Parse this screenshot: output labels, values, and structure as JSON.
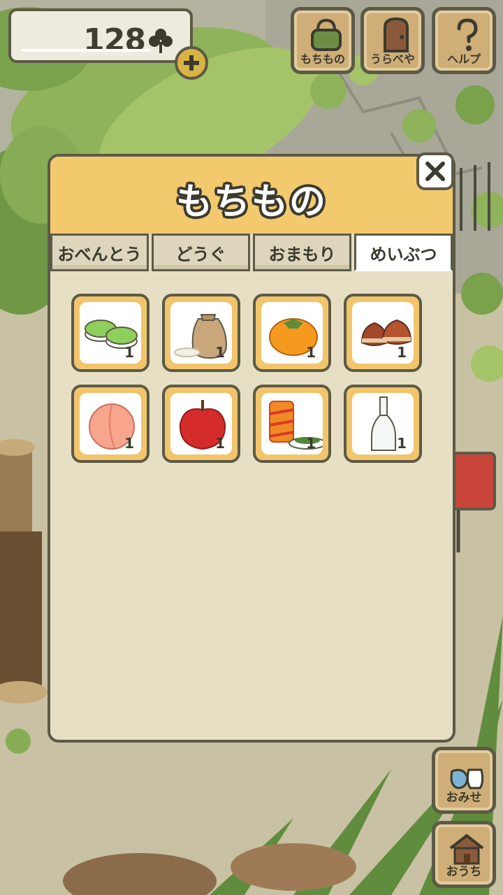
{
  "clover_counter": {
    "value": "128",
    "icon": "clover-icon",
    "add_icon": "plus-icon"
  },
  "top_menu": [
    {
      "label": "もちもの",
      "icon": "bag-icon"
    },
    {
      "label": "うらべや",
      "icon": "door-icon"
    },
    {
      "label": "ヘルプ",
      "icon": "question-icon"
    }
  ],
  "panel": {
    "title": "もちもの",
    "close_icon": "close-icon",
    "tabs": [
      {
        "label": "おべんとう",
        "active": false
      },
      {
        "label": "どうぐ",
        "active": false
      },
      {
        "label": "おまもり",
        "active": false
      },
      {
        "label": "めいぶつ",
        "active": true
      }
    ],
    "items": [
      {
        "icon": "green-mochi-icon",
        "quantity": "1"
      },
      {
        "icon": "rice-bag-icon",
        "quantity": "1"
      },
      {
        "icon": "persimmon-icon",
        "quantity": "1"
      },
      {
        "icon": "chestnut-icon",
        "quantity": "1"
      },
      {
        "icon": "peach-icon",
        "quantity": "1"
      },
      {
        "icon": "apple-icon",
        "quantity": "1"
      },
      {
        "icon": "tea-tin-icon",
        "quantity": "1"
      },
      {
        "icon": "glass-bottle-icon",
        "quantity": "1"
      }
    ]
  },
  "side_buttons": [
    {
      "label": "おみせ",
      "icon": "shop-icon"
    },
    {
      "label": "おうち",
      "icon": "house-icon"
    }
  ],
  "colors": {
    "outline": "#5c5a47",
    "panel_header": "#f3c96e",
    "panel_body": "#e7dfc4",
    "slot_frame": "#f2c56c",
    "wood_button": "#cfae78"
  }
}
